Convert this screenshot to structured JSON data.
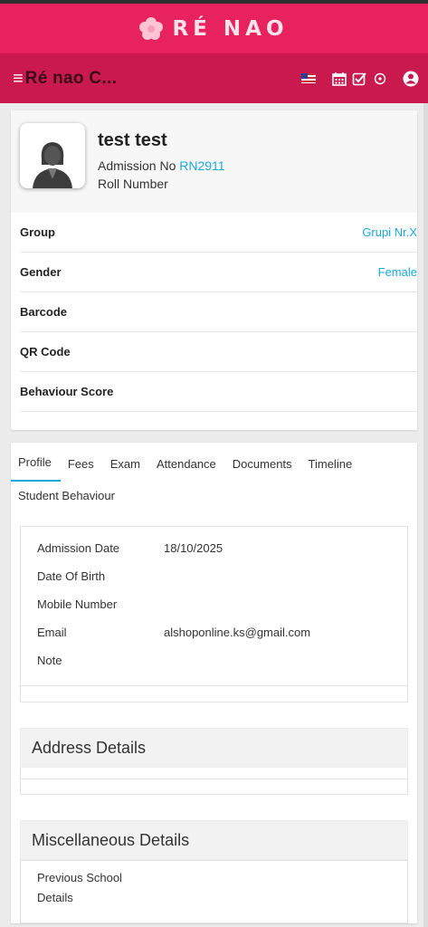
{
  "brand": {
    "name": "RÉ NAO"
  },
  "navbar": {
    "title": "Ré nao C...",
    "icons": [
      "menu-icon",
      "flag-icon",
      "calendar-icon",
      "checkbox-icon",
      "whatsapp-icon",
      "user-icon"
    ]
  },
  "profile": {
    "name": "test test",
    "admission_label": "Admission No",
    "admission_no": "RN2911",
    "roll_label": "Roll Number"
  },
  "details": [
    {
      "label": "Group",
      "value": "Grupi Nr.X"
    },
    {
      "label": "Gender",
      "value": "Female"
    },
    {
      "label": "Barcode",
      "value": ""
    },
    {
      "label": "QR Code",
      "value": ""
    },
    {
      "label": "Behaviour Score",
      "value": ""
    }
  ],
  "tabs": [
    "Profile",
    "Fees",
    "Exam",
    "Attendance",
    "Documents",
    "Timeline",
    "Student Behaviour"
  ],
  "profile_info": [
    {
      "label": "Admission Date",
      "value": "18/10/2025"
    },
    {
      "label": "Date Of Birth",
      "value": ""
    },
    {
      "label": "Mobile Number",
      "value": ""
    },
    {
      "label": "Email",
      "value": "alshoponline.ks@gmail.com"
    },
    {
      "label": "Note",
      "value": ""
    }
  ],
  "sections": {
    "address": "Address Details",
    "misc": "Miscellaneous Details",
    "prev_school": "Previous School Details"
  },
  "colors": {
    "brand": "#e8215f",
    "navbar": "#c9194f",
    "link": "#19a9e0"
  }
}
